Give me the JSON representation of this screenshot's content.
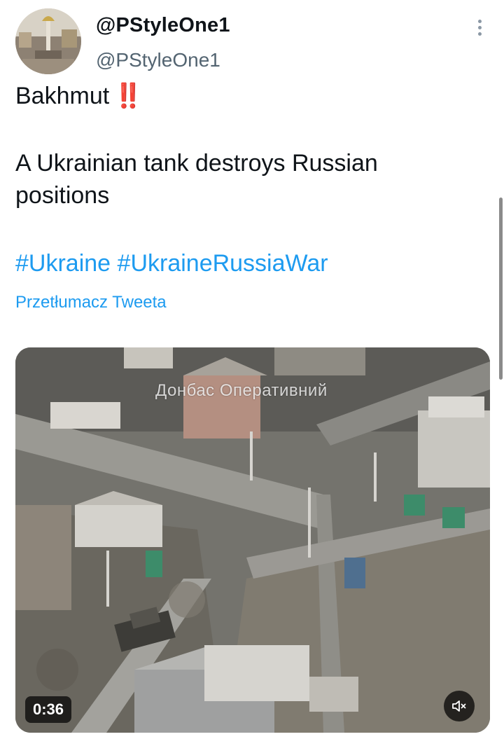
{
  "tweet": {
    "author": {
      "display_name": "@PStyleOne1",
      "handle": "@PStyleOne1"
    },
    "text_line1": "Bakhmut",
    "alert_emoji": "‼️",
    "text_line2": "A Ukrainian tank destroys Russian positions",
    "hashtags": [
      "#Ukraine",
      "#UkraineRussiaWar"
    ],
    "translate_label": "Przetłumacz Tweeta"
  },
  "media": {
    "watermark": "Донбас Оперативний",
    "duration": "0:36",
    "mute_icon": "volume-muted-icon"
  },
  "icons": {
    "more": "more-vertical-icon"
  },
  "colors": {
    "link": "#1d9bf0",
    "text": "#0f1419",
    "secondary": "#536471",
    "alert": "#e0102b"
  }
}
